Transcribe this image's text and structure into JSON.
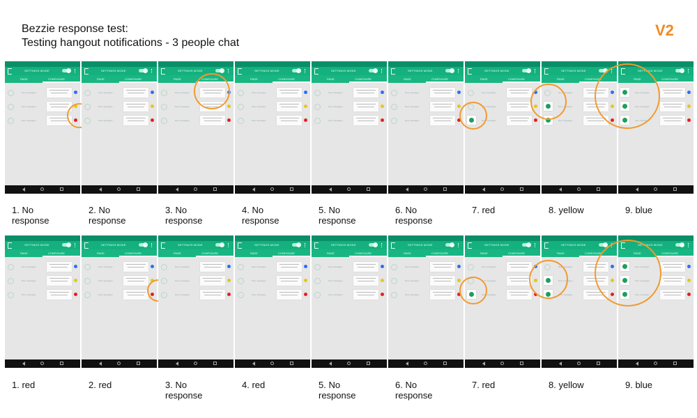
{
  "header": {
    "title_line1": "Bezzie response test:",
    "title_line2": "Testing hangout notifications - 3 people chat",
    "version": "V2"
  },
  "phone_ui": {
    "app_title": "SETTINGS MODE",
    "tab_left": "PAGE",
    "tab_right": "CONFIGURE",
    "row_label": "New messages",
    "card_text": "Message preview",
    "dot_colors": [
      "#2e6ff2",
      "#e7c61a",
      "#e32020"
    ],
    "accent_color": "#f29a2e",
    "toolbar_color": "#14b07e"
  },
  "rows": [
    {
      "captions": [
        "1. No\nresponse",
        "2. No\nresponse",
        "3. No\nresponse",
        "4. No\nresponse",
        "5. No\nresponse",
        "6. No\nresponse",
        "7. red",
        "8. yellow",
        "9. blue"
      ]
    },
    {
      "captions": [
        "1. red",
        "2. red",
        "3. No\nresponse",
        "4. red",
        "5. No\nresponse",
        "6. No\nresponse",
        "7. red",
        "8. yellow",
        "9. blue"
      ]
    }
  ]
}
